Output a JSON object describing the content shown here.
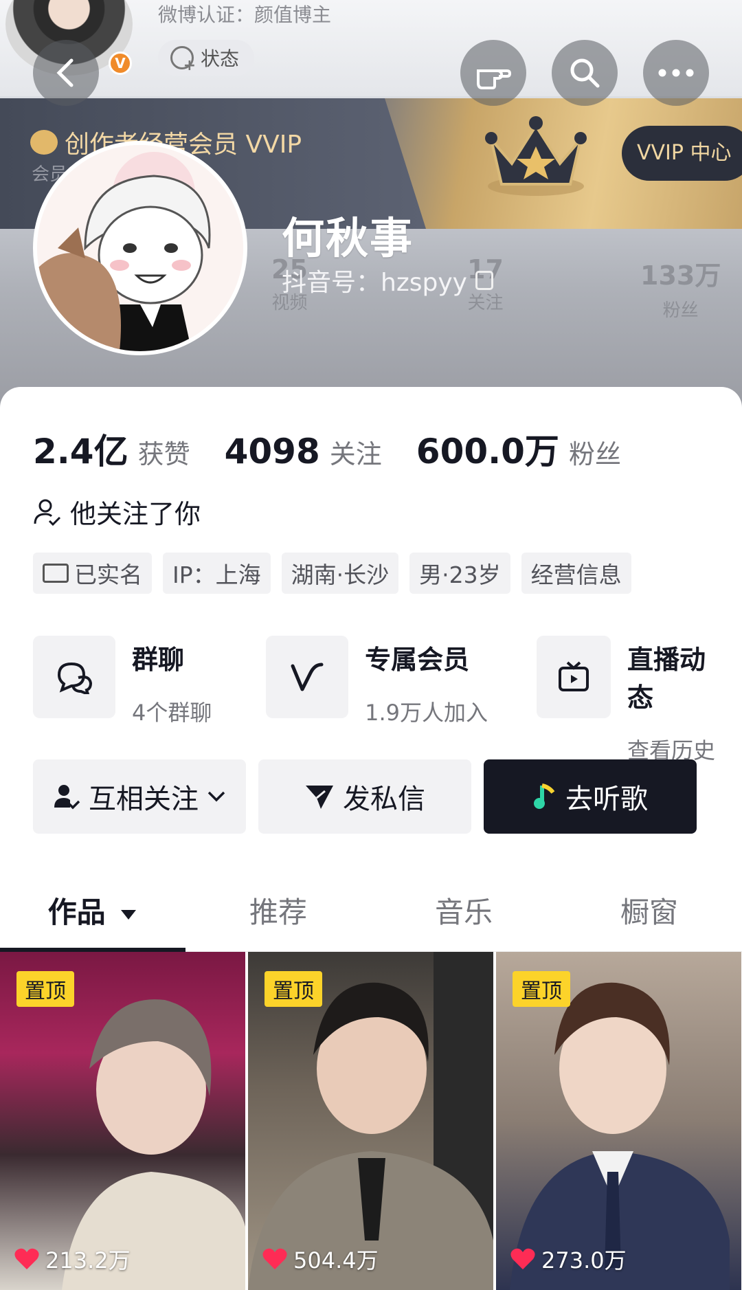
{
  "header": {
    "weibo_cert": "微博认证：颜值博主",
    "status_label": "状态",
    "vvip_title": "创作者经营会员 VVIP",
    "vvip_sub": "会员成长 >",
    "vvip_center": "VVIP 中心",
    "faded_stats": [
      {
        "num": "25",
        "label": "视频"
      },
      {
        "num": "17",
        "label": "关注"
      },
      {
        "num": "133万",
        "label": "粉丝"
      }
    ],
    "nickname": "何秋事",
    "douyin_id": "抖音号：hzspyy"
  },
  "stats": [
    {
      "num": "2.4亿",
      "label": "获赞"
    },
    {
      "num": "4098",
      "label": "关注"
    },
    {
      "num": "600.0万",
      "label": "粉丝"
    }
  ],
  "follows_you": "他关注了你",
  "tags": [
    "已实名",
    "IP：上海",
    "湖南·长沙",
    "男·23岁",
    "经营信息"
  ],
  "features": [
    {
      "title": "群聊",
      "sub": "4个群聊",
      "icon": "chat-bubbles-icon"
    },
    {
      "title": "专属会员",
      "sub": "1.9万人加入",
      "icon": "v-member-icon"
    },
    {
      "title": "直播动态",
      "sub": "查看历史",
      "icon": "tv-live-icon"
    }
  ],
  "actions": {
    "mutual": "互相关注",
    "dm": "发私信",
    "music": "去听歌"
  },
  "tabs": [
    "作品",
    "推荐",
    "音乐",
    "橱窗"
  ],
  "videos": [
    {
      "pin": "置顶",
      "likes": "213.2万"
    },
    {
      "pin": "置顶",
      "likes": "504.4万"
    },
    {
      "pin": "置顶",
      "likes": "273.0万"
    }
  ],
  "colors": {
    "accent_dark": "#161823",
    "pin_yellow": "#fcd32a",
    "heart_red": "#fe2c55",
    "vvip_gold": "#f3d8a5"
  }
}
